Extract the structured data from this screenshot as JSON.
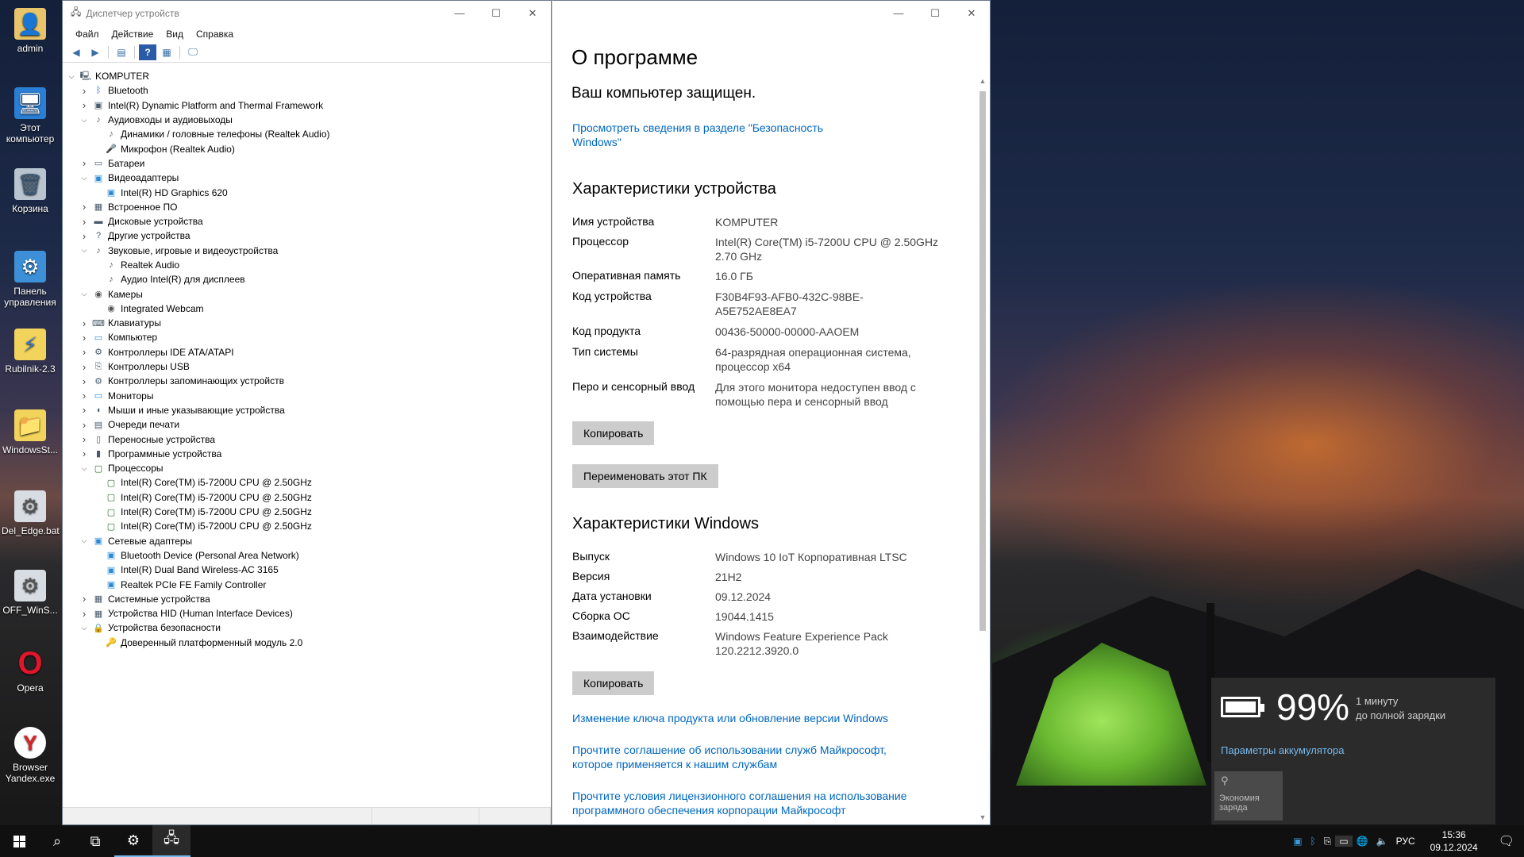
{
  "desktop": {
    "icons": [
      {
        "label": "admin",
        "icon": "user-folder-icon"
      },
      {
        "label": "Этот компьютер",
        "icon": "computer-icon"
      },
      {
        "label": "Корзина",
        "icon": "recycle-bin-icon"
      },
      {
        "label": "Панель управления",
        "icon": "control-panel-icon"
      },
      {
        "label": "Rubilnik-2.3",
        "icon": "app-icon"
      },
      {
        "label": "WindowsSt...",
        "icon": "folder-icon"
      },
      {
        "label": "Del_Edge.bat",
        "icon": "batch-file-icon"
      },
      {
        "label": "OFF_WinS...",
        "icon": "batch-file-icon"
      },
      {
        "label": "Opera",
        "icon": "opera-icon"
      },
      {
        "label": "Browser Yandex.exe",
        "icon": "yandex-browser-icon"
      }
    ]
  },
  "device_manager": {
    "title": "Диспетчер устройств",
    "menu": [
      "Файл",
      "Действие",
      "Вид",
      "Справка"
    ],
    "tree": [
      {
        "level": 0,
        "expanded": true,
        "label": "KOMPUTER",
        "icon": "computer-icon"
      },
      {
        "level": 1,
        "expanded": false,
        "label": "Bluetooth",
        "icon": "bluetooth-icon"
      },
      {
        "level": 1,
        "expanded": false,
        "label": "Intel(R) Dynamic Platform and Thermal Framework",
        "icon": "device-icon"
      },
      {
        "level": 1,
        "expanded": true,
        "label": "Аудиовходы и аудиовыходы",
        "icon": "speaker-icon"
      },
      {
        "level": 2,
        "expanded": null,
        "label": "Динамики / головные телефоны (Realtek Audio)",
        "icon": "speaker-icon"
      },
      {
        "level": 2,
        "expanded": null,
        "label": "Микрофон (Realtek Audio)",
        "icon": "microphone-icon"
      },
      {
        "level": 1,
        "expanded": false,
        "label": "Батареи",
        "icon": "battery-icon"
      },
      {
        "level": 1,
        "expanded": true,
        "label": "Видеоадаптеры",
        "icon": "display-adapter-icon"
      },
      {
        "level": 2,
        "expanded": null,
        "label": "Intel(R) HD Graphics 620",
        "icon": "display-adapter-icon"
      },
      {
        "level": 1,
        "expanded": false,
        "label": "Встроенное ПО",
        "icon": "firmware-icon"
      },
      {
        "level": 1,
        "expanded": false,
        "label": "Дисковые устройства",
        "icon": "disk-icon"
      },
      {
        "level": 1,
        "expanded": false,
        "label": "Другие устройства",
        "icon": "unknown-device-icon"
      },
      {
        "level": 1,
        "expanded": true,
        "label": "Звуковые, игровые и видеоустройства",
        "icon": "speaker-icon"
      },
      {
        "level": 2,
        "expanded": null,
        "label": "Realtek Audio",
        "icon": "speaker-icon"
      },
      {
        "level": 2,
        "expanded": null,
        "label": "Аудио Intel(R) для дисплеев",
        "icon": "speaker-icon"
      },
      {
        "level": 1,
        "expanded": true,
        "label": "Камеры",
        "icon": "camera-icon"
      },
      {
        "level": 2,
        "expanded": null,
        "label": "Integrated Webcam",
        "icon": "camera-icon"
      },
      {
        "level": 1,
        "expanded": false,
        "label": "Клавиатуры",
        "icon": "keyboard-icon"
      },
      {
        "level": 1,
        "expanded": false,
        "label": "Компьютер",
        "icon": "monitor-icon"
      },
      {
        "level": 1,
        "expanded": false,
        "label": "Контроллеры IDE ATA/ATAPI",
        "icon": "controller-icon"
      },
      {
        "level": 1,
        "expanded": false,
        "label": "Контроллеры USB",
        "icon": "usb-icon"
      },
      {
        "level": 1,
        "expanded": false,
        "label": "Контроллеры запоминающих устройств",
        "icon": "controller-icon"
      },
      {
        "level": 1,
        "expanded": false,
        "label": "Мониторы",
        "icon": "monitor-icon"
      },
      {
        "level": 1,
        "expanded": false,
        "label": "Мыши и иные указывающие устройства",
        "icon": "mouse-icon"
      },
      {
        "level": 1,
        "expanded": false,
        "label": "Очереди печати",
        "icon": "printer-icon"
      },
      {
        "level": 1,
        "expanded": false,
        "label": "Переносные устройства",
        "icon": "portable-device-icon"
      },
      {
        "level": 1,
        "expanded": false,
        "label": "Программные устройства",
        "icon": "software-device-icon"
      },
      {
        "level": 1,
        "expanded": true,
        "label": "Процессоры",
        "icon": "processor-icon"
      },
      {
        "level": 2,
        "expanded": null,
        "label": "Intel(R) Core(TM) i5-7200U CPU @ 2.50GHz",
        "icon": "processor-icon"
      },
      {
        "level": 2,
        "expanded": null,
        "label": "Intel(R) Core(TM) i5-7200U CPU @ 2.50GHz",
        "icon": "processor-icon"
      },
      {
        "level": 2,
        "expanded": null,
        "label": "Intel(R) Core(TM) i5-7200U CPU @ 2.50GHz",
        "icon": "processor-icon"
      },
      {
        "level": 2,
        "expanded": null,
        "label": "Intel(R) Core(TM) i5-7200U CPU @ 2.50GHz",
        "icon": "processor-icon"
      },
      {
        "level": 1,
        "expanded": true,
        "label": "Сетевые адаптеры",
        "icon": "network-adapter-icon"
      },
      {
        "level": 2,
        "expanded": null,
        "label": "Bluetooth Device (Personal Area Network)",
        "icon": "network-adapter-icon"
      },
      {
        "level": 2,
        "expanded": null,
        "label": "Intel(R) Dual Band Wireless-AC 3165",
        "icon": "network-adapter-icon"
      },
      {
        "level": 2,
        "expanded": null,
        "label": "Realtek PCIe FE Family Controller",
        "icon": "network-adapter-icon"
      },
      {
        "level": 1,
        "expanded": false,
        "label": "Системные устройства",
        "icon": "system-device-icon"
      },
      {
        "level": 1,
        "expanded": false,
        "label": "Устройства HID (Human Interface Devices)",
        "icon": "hid-icon"
      },
      {
        "level": 1,
        "expanded": true,
        "label": "Устройства безопасности",
        "icon": "security-device-icon"
      },
      {
        "level": 2,
        "expanded": null,
        "label": "Доверенный платформенный модуль 2.0",
        "icon": "tpm-icon"
      }
    ]
  },
  "about": {
    "heading": "О программе",
    "protected": "Ваш компьютер защищен.",
    "security_link": "Просмотреть сведения в разделе \"Безопасность Windows\"",
    "device_specs_title": "Характеристики устройства",
    "device_specs": [
      {
        "k": "Имя устройства",
        "v": "KOMPUTER"
      },
      {
        "k": "Процессор",
        "v": "Intel(R) Core(TM) i5-7200U CPU @ 2.50GHz 2.70 GHz"
      },
      {
        "k": "Оперативная память",
        "v": "16.0 ГБ"
      },
      {
        "k": "Код устройства",
        "v": "F30B4F93-AFB0-432C-98BE-A5E752AE8EA7"
      },
      {
        "k": "Код продукта",
        "v": "00436-50000-00000-AAOEM"
      },
      {
        "k": "Тип системы",
        "v": "64-разрядная операционная система, процессор x64"
      },
      {
        "k": "Перо и сенсорный ввод",
        "v": "Для этого монитора недоступен ввод с помощью пера и сенсорный ввод"
      }
    ],
    "copy_label": "Копировать",
    "rename_label": "Переименовать этот ПК",
    "windows_specs_title": "Характеристики Windows",
    "windows_specs": [
      {
        "k": "Выпуск",
        "v": "Windows 10 IoT Корпоративная LTSC"
      },
      {
        "k": "Версия",
        "v": "21H2"
      },
      {
        "k": "Дата установки",
        "v": "09.12.2024"
      },
      {
        "k": "Сборка ОС",
        "v": "19044.1415"
      },
      {
        "k": "Взаимодействие",
        "v": "Windows Feature Experience Pack 120.2212.3920.0"
      }
    ],
    "copy2_label": "Копировать",
    "links": [
      "Изменение ключа продукта или обновление версии Windows",
      "Прочтите соглашение об использовании служб Майкрософт, которое применяется к нашим службам",
      "Прочтите условия лицензионного соглашения на использование программного обеспечения корпорации Майкрософт"
    ]
  },
  "battery": {
    "percent": "99%",
    "time": "1 минуту",
    "status": "до полной зарядки",
    "settings_link": "Параметры аккумулятора",
    "saver_label": "Экономия заряда"
  },
  "taskbar": {
    "lang": "РУС",
    "time": "15:36",
    "date": "09.12.2024"
  },
  "colors": {
    "link": "#0067c0",
    "accent": "#0078d7"
  }
}
